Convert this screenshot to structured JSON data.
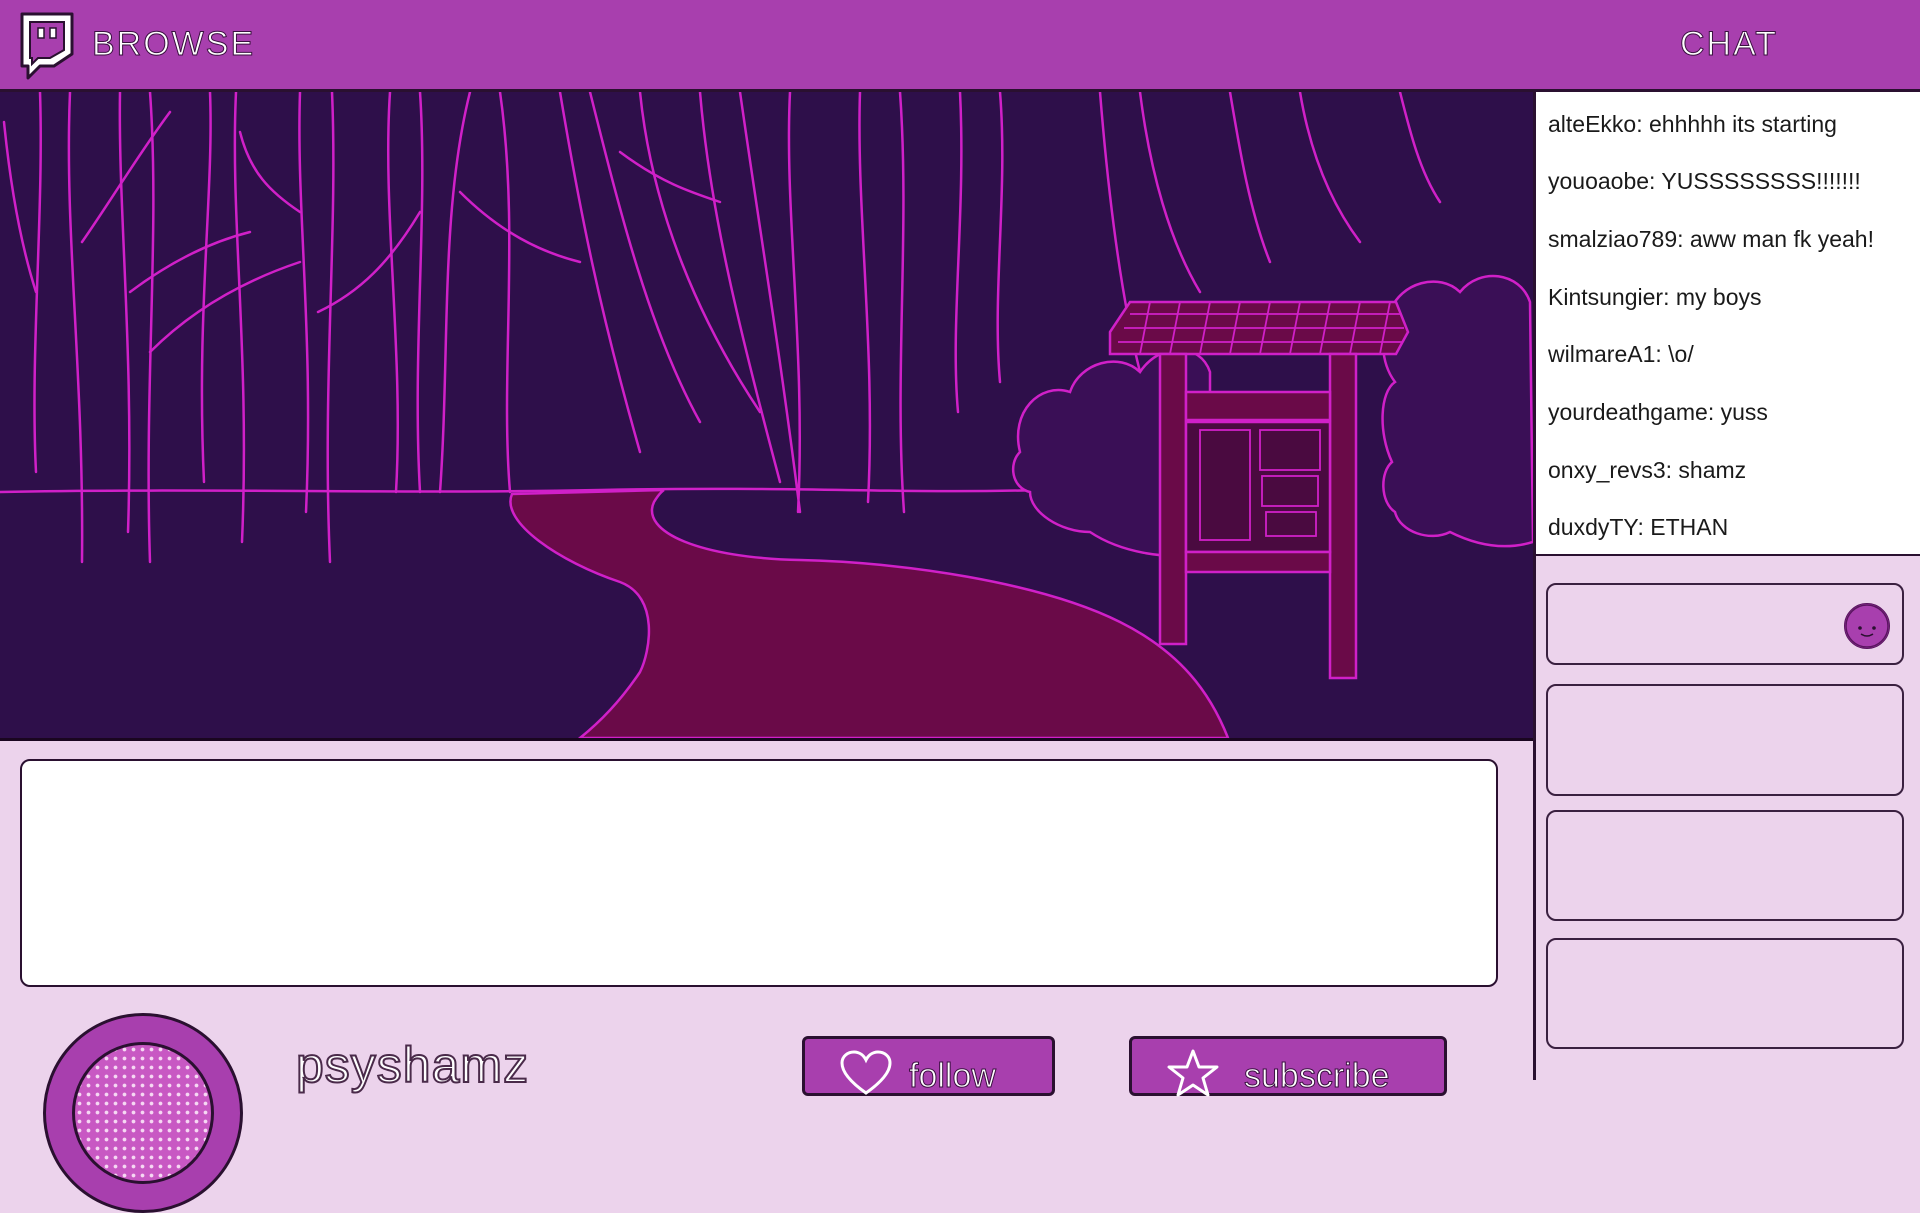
{
  "header": {
    "browse_label": "BROWSE",
    "chat_title": "CHAT",
    "logo_icon": "speech-bubble-logo-icon"
  },
  "chat": {
    "messages": [
      {
        "text": "alteEkko: ehhhhh its starting"
      },
      {
        "text": "youoaobe: YUSSSSSSSS!!!!!!!"
      },
      {
        "text": "smalziao789: aww man fk yeah!"
      },
      {
        "text": "Kintsungier: my boys"
      },
      {
        "text": "wilmareA1: \\o/"
      },
      {
        "text": "yourdeathgame: yuss"
      },
      {
        "text": "onxy_revs3: shamz"
      },
      {
        "text": "duxdyTY: ETHAN"
      }
    ],
    "emote_icon": "smiley-emote-icon"
  },
  "stream": {
    "scene": "forest path with notice board"
  },
  "streamer": {
    "name": "psyshamz"
  },
  "actions": {
    "follow_label": "follow",
    "subscribe_label": "subscribe",
    "follow_icon": "heart-icon",
    "subscribe_icon": "star-icon"
  },
  "colors": {
    "brand": "#a83fae",
    "panel": "#ecd3ec",
    "video_bg": "#2e0f4a",
    "line_art": "#d020c8",
    "path": "#6a0a48"
  }
}
